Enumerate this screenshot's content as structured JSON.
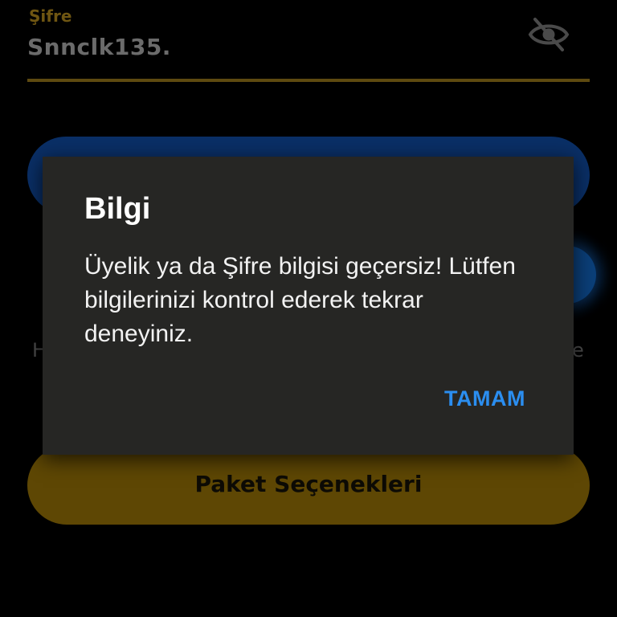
{
  "form": {
    "password_label": "Şifre",
    "password_value": "Snnclk135.",
    "peek_left": "H",
    "peek_right": "e"
  },
  "buttons": {
    "package_options": "Paket Seçenekleri"
  },
  "side_handle": {
    "glyph": "«"
  },
  "dialog": {
    "title": "Bilgi",
    "message": "Üyelik ya da Şifre bilgisi geçersiz! Lütfen bilgilerinizi kontrol ederek tekrar deneyiniz.",
    "ok_label": "TAMAM"
  },
  "colors": {
    "accent_gold": "#6f5612",
    "primary_blue": "#0a2f66",
    "dialog_bg": "#262624",
    "dialog_action": "#2b8ef0"
  },
  "icons": {
    "password_toggle": "eye-off-icon",
    "drawer_handle": "double-chevron-left-icon"
  }
}
